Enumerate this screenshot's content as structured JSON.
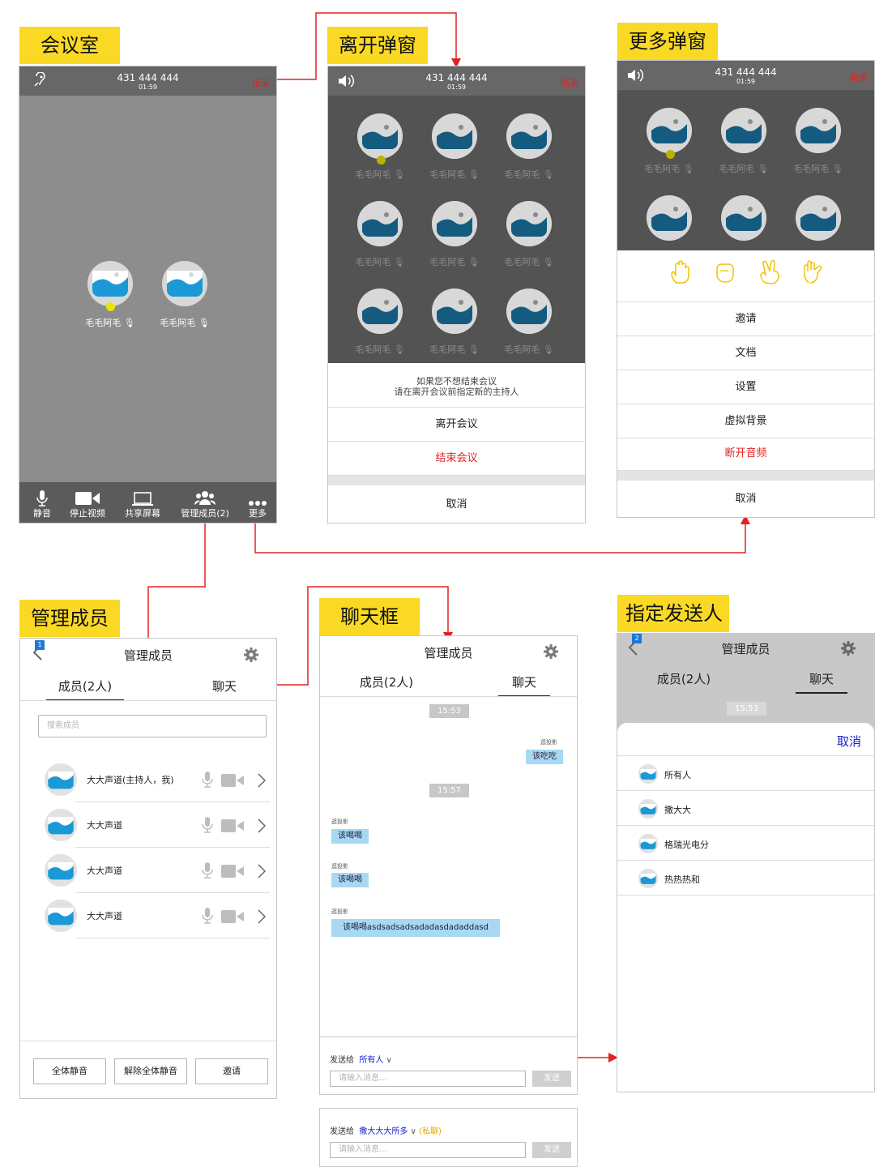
{
  "labels": {
    "meeting": "会议室",
    "leave": "离开弹窗",
    "more": "更多弹窗",
    "members": "管理成员",
    "chat": "聊天框",
    "recipient": "指定发送人"
  },
  "meeting_bar": {
    "number": "431 444 444",
    "time": "01:59",
    "end": "结束"
  },
  "participant_name": "毛毛阿毛",
  "toolbar": {
    "mute": "静音",
    "stop_video": "停止视频",
    "share": "共享屏幕",
    "manage": "管理成员(2)",
    "more": "更多"
  },
  "leave_dialog": {
    "hint1": "如果您不想结束会议",
    "hint2": "请在离开会议前指定新的主持人",
    "leave": "离开会议",
    "end": "结束会议",
    "cancel": "取消"
  },
  "more_dialog": {
    "items": [
      "邀请",
      "文档",
      "设置",
      "虚拟背景"
    ],
    "disconnect": "断开音频",
    "cancel": "取消"
  },
  "members_panel": {
    "title": "管理成员",
    "tab_members": "成员(2人)",
    "tab_chat": "聊天",
    "badge": "1",
    "search_placeholder": "搜索成员",
    "members": [
      "大大声道(主持人，我)",
      "大大声道",
      "大大声道",
      "大大声道"
    ],
    "mute_all": "全体静音",
    "unmute_all": "解除全体静音",
    "invite": "邀请"
  },
  "chat_panel": {
    "title": "管理成员",
    "tab_members": "成员(2人)",
    "tab_chat": "聊天",
    "time1": "15:53",
    "time2": "15:57",
    "sender": "逛投影",
    "msg_self": "该吃吃",
    "msg1": "该喝喝",
    "msg2": "该喝喝",
    "msg3": "该喝喝asdsadsadsadadasdadaddasd",
    "send_to": "发送给",
    "send_all": "所有人",
    "input_placeholder": "请输入消息...",
    "send": "发送",
    "send_to2": "发送给",
    "send_private_name": "撒大大大所多",
    "private_tag": "(私聊)"
  },
  "recipient_panel": {
    "title": "管理成员",
    "tab_members": "成员(2人)",
    "tab_chat": "聊天",
    "badge": "2",
    "time": "15:53",
    "cancel": "取消",
    "options": [
      "所有人",
      "撒大大",
      "格瑞光电分",
      "热热热和"
    ]
  },
  "colors": {
    "label_yellow": "#f9d924",
    "connector_red": "#e02424",
    "bubble_blue": "#a7d8f4",
    "avatar_blue": "#1b98d6"
  }
}
